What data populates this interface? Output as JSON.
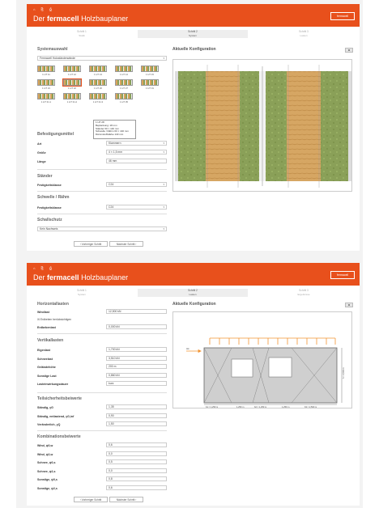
{
  "app": {
    "title_prefix": "Der",
    "title_brand": "fermacell",
    "title_rest": "Holzbauplaner",
    "header_icons": "⌂ ⎘ ⎙",
    "logo": "fermacell"
  },
  "screen1": {
    "steps": [
      {
        "num": "Schritt 1",
        "label": "Statik"
      },
      {
        "num": "Schritt 2",
        "label": "System"
      },
      {
        "num": "Schritt 3",
        "label": "Lasten"
      }
    ],
    "systemauswahl": {
      "title": "Systemauswahl",
      "select_value": "Fermacell Holzständerwände",
      "thumbs": [
        "1 HT 11",
        "1 HT 12",
        "1 HT 13",
        "1 HT 14",
        "1 HT 15",
        "1 HT 21",
        "1 HT 22",
        "1 HT 26",
        "1 HT 27",
        "1 HT 31",
        "1 HT 31.1",
        "1 HT 31.2",
        "1 HT 31.3",
        "1 HT 35"
      ],
      "tooltip": [
        "1 HT 28",
        "Beplankung: 18 mm",
        "Ständer 60 × 140 mm",
        "Schwelle / Rähm 60 × 140 mm",
        "Dämmstoffstärke 140 mm"
      ]
    },
    "befestigung": {
      "title": "Befestigungsmittel",
      "art_label": "Art",
      "art_value": "Klammern",
      "groesse_label": "Größe",
      "groesse_value": "4 × 1,5 mm",
      "laenge_label": "Länge",
      "laenge_value": "46 mm"
    },
    "staender": {
      "title": "Ständer",
      "label": "Festigkeitsklasse",
      "value": "C24"
    },
    "schwelle": {
      "title": "Schwelle / Rähm",
      "label": "Festigkeitsklasse",
      "value": "C24"
    },
    "schallschutz": {
      "title": "Schallschutz",
      "value": "Kein Nachweis"
    },
    "config": {
      "title": "Aktuelle Konfiguration",
      "zoom": "⊠"
    },
    "buttons": {
      "prev": "‹ Vorheriger Schritt",
      "next": "Nächster Schritt ›"
    }
  },
  "screen2": {
    "steps": [
      {
        "num": "Schritt 1",
        "label": "System"
      },
      {
        "num": "Schritt 2",
        "label": "Lasten"
      },
      {
        "num": "Schritt 3",
        "label": "Ergebnisse"
      }
    ],
    "horizontal": {
      "title": "Horizontallasten",
      "wind_label": "Windlast",
      "wind_value": "12,500 kN",
      "checkbox_label": "Erdbeben berücksichtigen",
      "erdbeben_label": "Erdbebenlast",
      "erdbeben_value": "0,000 kN"
    },
    "vertikal": {
      "title": "Vertikallasten",
      "rows": [
        {
          "label": "Eigenlast",
          "value": "1,700 kN"
        },
        {
          "label": "Schneelast",
          "value": "3,510 kN"
        },
        {
          "label": "Geländehöhe",
          "value": "200 m"
        },
        {
          "label": "Sonstige Last",
          "value": "0,860 kN"
        },
        {
          "label": "Lasteinwirkungsdauer",
          "value": "kurz"
        }
      ]
    },
    "teilsicherheit": {
      "title": "Teilsicherheitsbeiwerte",
      "rows": [
        {
          "label": "Ständig, γG",
          "value": "1,35"
        },
        {
          "label": "Ständig, entlastend, γG,inf",
          "value": "0,90"
        },
        {
          "label": "Veränderlich, γQ",
          "value": "1,50"
        }
      ]
    },
    "kombination": {
      "title": "Kombinationsbeiwerte",
      "rows": [
        {
          "label": "Wind, ψ0,w",
          "value": "0,6"
        },
        {
          "label": "Wind, ψ2,w",
          "value": "0,0"
        },
        {
          "label": "Schnee, ψ0,s",
          "value": "0,5"
        },
        {
          "label": "Schnee, ψ2,s",
          "value": "0,0"
        },
        {
          "label": "Sonstige, ψ0,s",
          "value": "0,8"
        },
        {
          "label": "Sonstige, ψ2,s",
          "value": "0,6"
        }
      ]
    },
    "config": {
      "title": "Aktuelle Konfiguration",
      "zoom": "⊠",
      "dims": [
        "b1 = 1,250 m",
        "1,250 m",
        "b2 = 1,250 m",
        "1,250 m",
        "b3 = 2,500 m"
      ],
      "height": "h = 2,500 m",
      "force": "Hk"
    },
    "buttons": {
      "prev": "‹ Vorheriger Schritt",
      "next": "Nächster Schritt ›"
    }
  },
  "colors": {
    "brand": "#e8501c",
    "wood": "#d4a15e",
    "insulation": "#8aa058",
    "load_arrow": "#f29433"
  }
}
